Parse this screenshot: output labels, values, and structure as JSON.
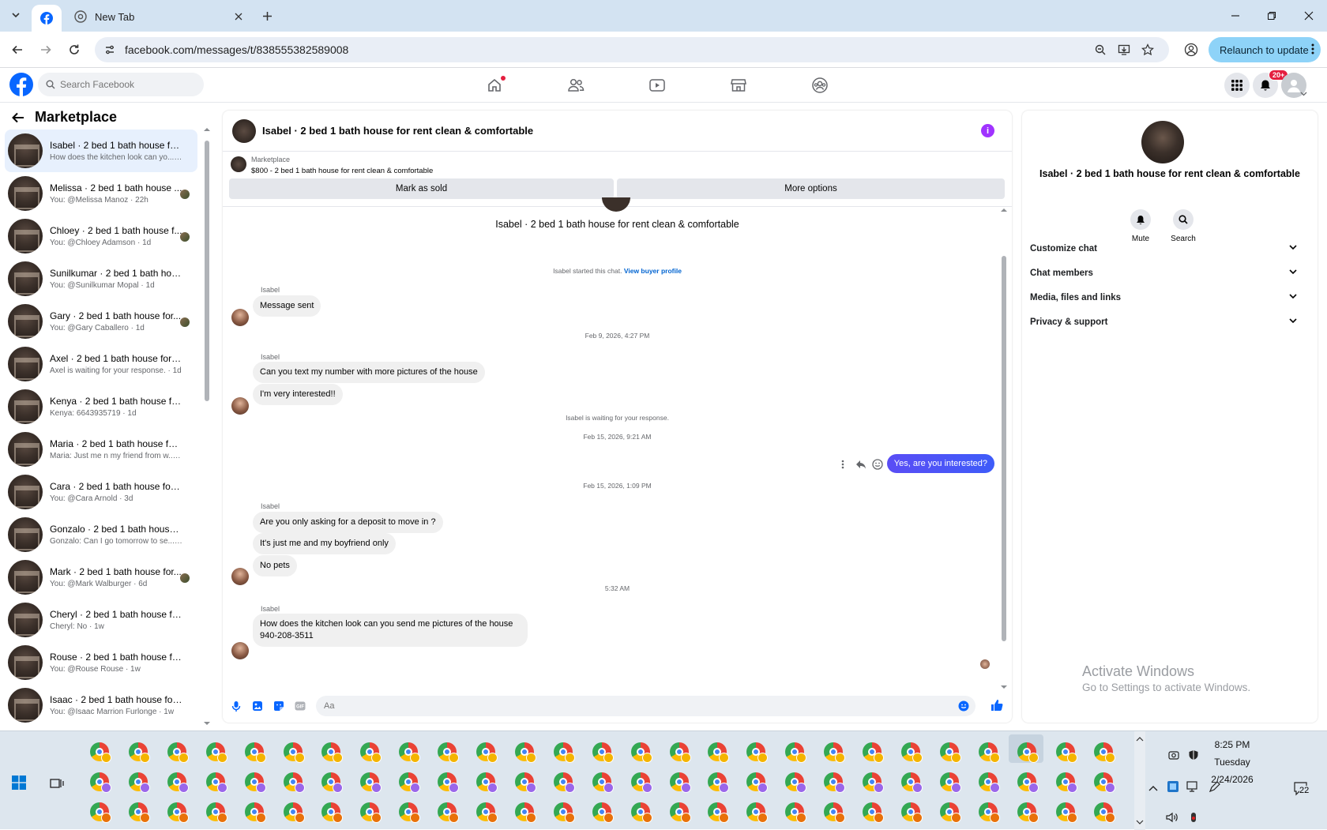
{
  "browser": {
    "tab_active_icon": "facebook-icon",
    "tab_new_title": "New Tab",
    "url": "facebook.com/messages/t/838555382589008",
    "relaunch_label": "Relaunch to update"
  },
  "fb": {
    "search_placeholder": "Search Facebook",
    "notif_badge": "20+"
  },
  "left": {
    "title": "Marketplace",
    "conversations": [
      {
        "name": "Isabel · 2 bed 1 bath house for r...",
        "sub": "How does the kitchen look can yo... · 1h",
        "selected": true
      },
      {
        "name": "Melissa · 2 bed 1 bath house ...",
        "sub": "You: @Melissa Manoz · 22h"
      },
      {
        "name": "Chloey · 2 bed 1 bath house f...",
        "sub": "You: @Chloey Adamson · 1d"
      },
      {
        "name": "Sunilkumar · 2 bed 1 bath hous...",
        "sub": "You: @Sunilkumar Mopal · 1d"
      },
      {
        "name": "Gary · 2 bed 1 bath house for...",
        "sub": "You: @Gary Caballero · 1d"
      },
      {
        "name": "Axel · 2 bed 1 bath house for re...",
        "sub": "Axel is waiting for your response. · 1d"
      },
      {
        "name": "Kenya · 2 bed 1 bath house for r...",
        "sub": "Kenya: 6643935719 · 1d"
      },
      {
        "name": "Maria · 2 bed 1 bath house for r...",
        "sub": "Maria: Just me n my friend from w... · 3d"
      },
      {
        "name": "Cara · 2 bed 1 bath house for re...",
        "sub": "You: @Cara Arnold · 3d"
      },
      {
        "name": "Gonzalo · 2 bed 1 bath house fo...",
        "sub": "Gonzalo: Can I go tomorrow to se... · 6d"
      },
      {
        "name": "Mark · 2 bed 1 bath house for...",
        "sub": "You: @Mark Walburger · 6d"
      },
      {
        "name": "Cheryl · 2 bed 1 bath house for ...",
        "sub": "Cheryl: No · 1w"
      },
      {
        "name": "Rouse · 2 bed 1 bath house for r...",
        "sub": "You: @Rouse Rouse · 1w"
      },
      {
        "name": "Isaac · 2 bed 1 bath house for re...",
        "sub": "You: @Isaac Marrion Furlonge · 1w"
      }
    ]
  },
  "chat": {
    "title": "Isabel · 2 bed 1 bath house for rent clean & comfortable",
    "marketplace_label": "Marketplace",
    "listing": "$800 - 2 bed 1 bath house for rent clean & comfortable",
    "mark_sold": "Mark as sold",
    "more_options": "More options",
    "listing_heading": "Isabel · 2 bed 1 bath house for rent clean & comfortable",
    "started": "Isabel started this chat.",
    "view_buyer": "View buyer profile",
    "sender": "Isabel",
    "msg1": "Message sent",
    "ts1": "Feb 9, 2026, 4:27 PM",
    "msg2": "Can you text my number with more pictures of the house",
    "msg3": "I'm very interested!!",
    "waiting": "Isabel is waiting for your response.",
    "ts2": "Feb 15, 2026, 9:21 AM",
    "mine1": "Yes, are you interested?",
    "ts3": "Feb 15, 2026, 1:09 PM",
    "msg4": "Are you only asking for a deposit to move in ?",
    "msg5": "It's just me and my boyfriend only",
    "msg6": "No pets",
    "ts4": "5:32 AM",
    "msg7a": "How does the kitchen look can you send me pictures of the house",
    "msg7b": "940-208-3511",
    "composer_placeholder": "Aa"
  },
  "right": {
    "name": "Isabel · 2 bed 1 bath house for rent clean & comfortable",
    "mute": "Mute",
    "search": "Search",
    "sections": [
      "Customize chat",
      "Chat members",
      "Media, files and links",
      "Privacy & support"
    ]
  },
  "watermark": {
    "line1": "Activate Windows",
    "line2": "Go to Settings to activate Windows."
  },
  "taskbar": {
    "time": "8:25 PM",
    "day": "Tuesday",
    "date": "2/24/2026",
    "notif_count": "22"
  }
}
